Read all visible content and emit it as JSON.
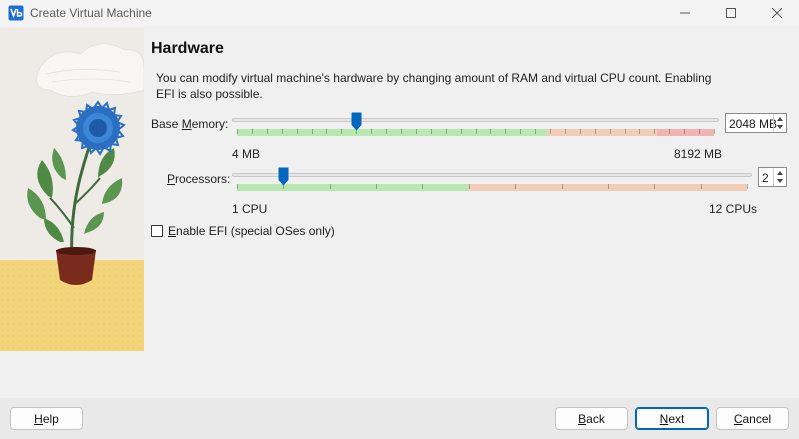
{
  "window": {
    "title": "Create Virtual Machine",
    "controls": [
      "minimize-icon",
      "maximize-icon",
      "close-icon"
    ]
  },
  "page": {
    "heading": "Hardware",
    "description": "You can modify virtual machine's hardware by changing amount of RAM and virtual CPU count. Enabling EFI is also possible."
  },
  "memory": {
    "label_pre": "Base ",
    "label_mnemonic": "M",
    "label_post": "emory:",
    "value": "2048 MB",
    "min_label": "4 MB",
    "max_label": "8192 MB",
    "min": 4,
    "max": 8192,
    "current": 2048
  },
  "processors": {
    "label_pre": "",
    "label_mnemonic": "P",
    "label_post": "rocessors:",
    "value": "2",
    "min_label": "1 CPU",
    "max_label": "12 CPUs",
    "min": 1,
    "max": 12,
    "current": 2
  },
  "efi": {
    "label_mnemonic": "E",
    "label_post": "nable EFI (special OSes only)",
    "checked": false
  },
  "buttons": {
    "help_mnemonic": "H",
    "help_post": "elp",
    "back_mnemonic": "B",
    "back_post": "ack",
    "next_mnemonic": "N",
    "next_post": "ext",
    "cancel_mnemonic": "C",
    "cancel_post": "ancel"
  },
  "colors": {
    "accent": "#0067c0",
    "safe_zone": "#b7e8b0",
    "warn_zone": "#f4cdb8",
    "danger_zone": "#f2b3b3"
  }
}
